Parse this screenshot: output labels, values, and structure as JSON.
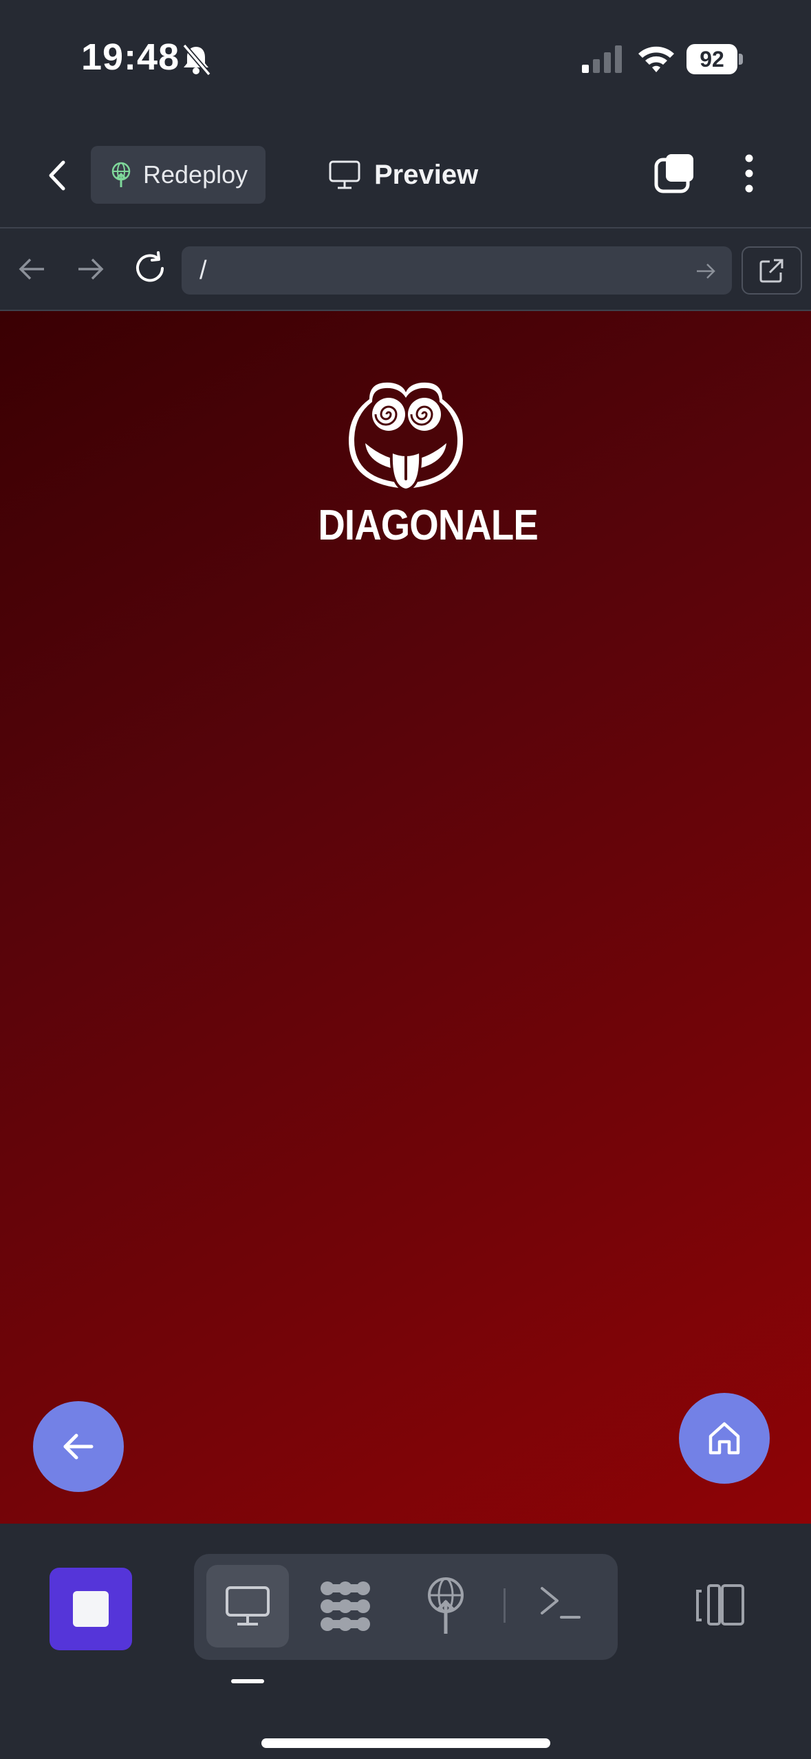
{
  "status_bar": {
    "time": "19:48",
    "battery_level": "92",
    "icons": [
      "bell-slash-icon",
      "cellular-signal-icon",
      "wifi-icon",
      "battery-icon"
    ]
  },
  "header": {
    "redeploy_label": "Redeploy",
    "preview_label": "Preview"
  },
  "browser": {
    "url_value": "/"
  },
  "preview": {
    "logo_text": "DIAGONALE",
    "background_colors": [
      "#3a0003",
      "#8e0306"
    ],
    "fab_color": "#7381e6"
  },
  "toolbar": {
    "accent": "#5535d9",
    "active_tool": "desktop",
    "tools": [
      "desktop-icon",
      "cluster-icon",
      "deploy-globe-icon",
      "terminal-icon"
    ]
  }
}
